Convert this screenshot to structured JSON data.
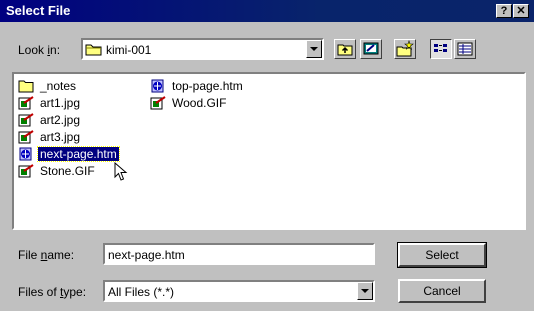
{
  "window": {
    "title": "Select File",
    "help_label": "?",
    "close_label": "✕"
  },
  "lookin": {
    "label_pre": "Look ",
    "label_accel": "i",
    "label_post": "n:",
    "value": "kimi-001",
    "folder_icon": "folder-icon"
  },
  "toolbar": {
    "icons": [
      "up-folder-icon",
      "desktop-icon",
      "new-folder-icon",
      "list-view-icon",
      "details-view-icon"
    ]
  },
  "files": {
    "col1": [
      {
        "name": "_notes",
        "icon": "folder-icon"
      },
      {
        "name": "art1.jpg",
        "icon": "image-icon"
      },
      {
        "name": "art2.jpg",
        "icon": "image-icon"
      },
      {
        "name": "art3.jpg",
        "icon": "image-icon"
      },
      {
        "name": "next-page.htm",
        "icon": "html-icon",
        "selected": true
      },
      {
        "name": "Stone.GIF",
        "icon": "image-icon"
      }
    ],
    "col2": [
      {
        "name": "top-page.htm",
        "icon": "html-icon"
      },
      {
        "name": "Wood.GIF",
        "icon": "image-icon"
      }
    ]
  },
  "filename": {
    "label_pre": "File ",
    "label_accel": "n",
    "label_post": "ame:",
    "value": "next-page.htm"
  },
  "filetype": {
    "label_pre": "Files of ",
    "label_accel": "t",
    "label_post": "ype:",
    "value": "All Files (*.*)"
  },
  "buttons": {
    "select_label": "Select",
    "cancel_label": "Cancel"
  }
}
